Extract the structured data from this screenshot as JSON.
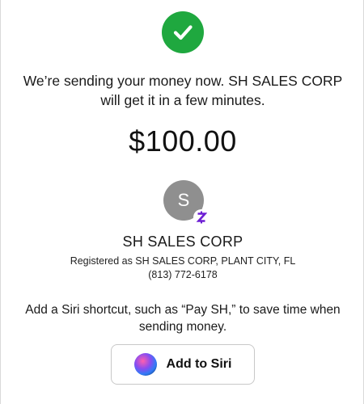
{
  "confirmation": {
    "message": "We’re sending your money now. SH SALES CORP will get it in a few minutes.",
    "amount": "$100.00"
  },
  "recipient": {
    "initial": "S",
    "name": "SH SALES CORP",
    "registered": "Registered as SH SALES CORP, PLANT CITY, FL",
    "phone": "(813) 772-6178"
  },
  "siri": {
    "prompt": "Add a Siri shortcut, such as “Pay SH,” to save time when sending money.",
    "button_label": "Add to Siri"
  },
  "colors": {
    "success": "#1fa83f",
    "avatar": "#8f8f8f",
    "badge": "#6d1ed4"
  },
  "icons": [
    "check-icon",
    "zelle-badge-icon",
    "siri-icon"
  ]
}
